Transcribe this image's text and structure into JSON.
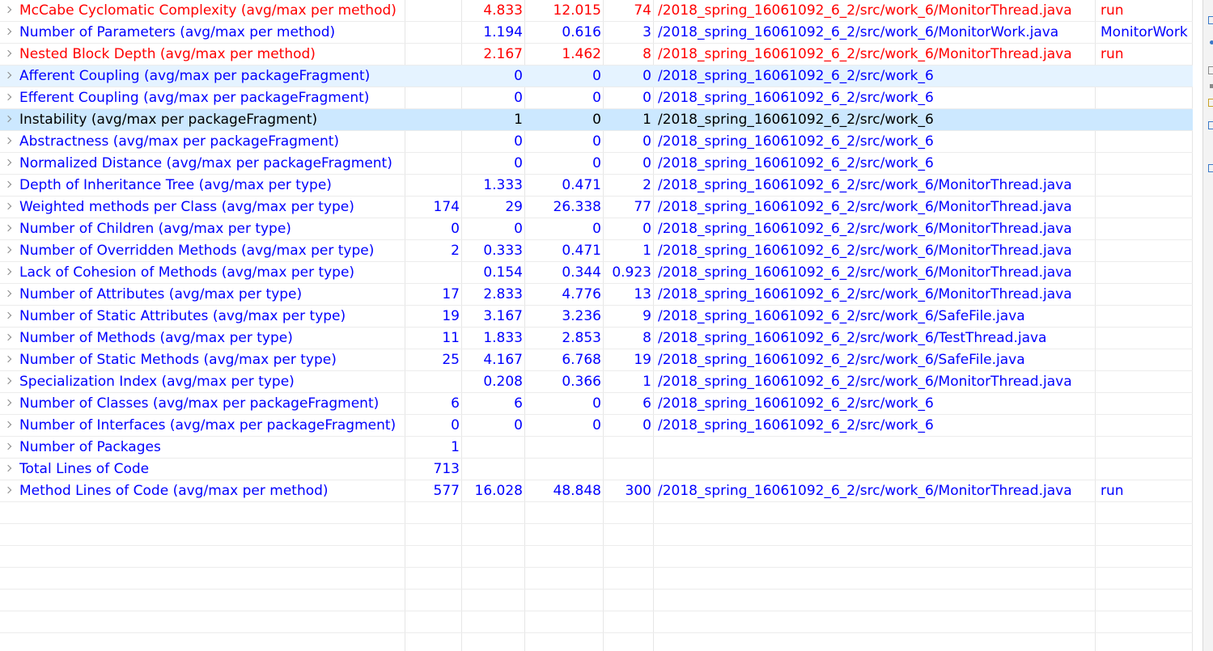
{
  "rows": [
    {
      "name": "McCabe Cyclomatic Complexity (avg/max per method)",
      "total": "",
      "mean": "4.833",
      "std": "12.015",
      "max": "74",
      "resource": "/2018_spring_16061092_6_2/src/work_6/MonitorThread.java",
      "method": "run",
      "state": "warn"
    },
    {
      "name": "Number of Parameters (avg/max per method)",
      "total": "",
      "mean": "1.194",
      "std": "0.616",
      "max": "3",
      "resource": "/2018_spring_16061092_6_2/src/work_6/MonitorWork.java",
      "method": "MonitorWork",
      "state": "normal"
    },
    {
      "name": "Nested Block Depth (avg/max per method)",
      "total": "",
      "mean": "2.167",
      "std": "1.462",
      "max": "8",
      "resource": "/2018_spring_16061092_6_2/src/work_6/MonitorThread.java",
      "method": "run",
      "state": "warn"
    },
    {
      "name": "Afferent Coupling (avg/max per packageFragment)",
      "total": "",
      "mean": "0",
      "std": "0",
      "max": "0",
      "resource": "/2018_spring_16061092_6_2/src/work_6",
      "method": "",
      "state": "hover"
    },
    {
      "name": "Efferent Coupling (avg/max per packageFragment)",
      "total": "",
      "mean": "0",
      "std": "0",
      "max": "0",
      "resource": "/2018_spring_16061092_6_2/src/work_6",
      "method": "",
      "state": "normal"
    },
    {
      "name": "Instability (avg/max per packageFragment)",
      "total": "",
      "mean": "1",
      "std": "0",
      "max": "1",
      "resource": "/2018_spring_16061092_6_2/src/work_6",
      "method": "",
      "state": "selected"
    },
    {
      "name": "Abstractness (avg/max per packageFragment)",
      "total": "",
      "mean": "0",
      "std": "0",
      "max": "0",
      "resource": "/2018_spring_16061092_6_2/src/work_6",
      "method": "",
      "state": "normal"
    },
    {
      "name": "Normalized Distance (avg/max per packageFragment)",
      "total": "",
      "mean": "0",
      "std": "0",
      "max": "0",
      "resource": "/2018_spring_16061092_6_2/src/work_6",
      "method": "",
      "state": "normal"
    },
    {
      "name": "Depth of Inheritance Tree (avg/max per type)",
      "total": "",
      "mean": "1.333",
      "std": "0.471",
      "max": "2",
      "resource": "/2018_spring_16061092_6_2/src/work_6/MonitorThread.java",
      "method": "",
      "state": "normal"
    },
    {
      "name": "Weighted methods per Class (avg/max per type)",
      "total": "174",
      "mean": "29",
      "std": "26.338",
      "max": "77",
      "resource": "/2018_spring_16061092_6_2/src/work_6/MonitorThread.java",
      "method": "",
      "state": "normal"
    },
    {
      "name": "Number of Children (avg/max per type)",
      "total": "0",
      "mean": "0",
      "std": "0",
      "max": "0",
      "resource": "/2018_spring_16061092_6_2/src/work_6/MonitorThread.java",
      "method": "",
      "state": "normal"
    },
    {
      "name": "Number of Overridden Methods (avg/max per type)",
      "total": "2",
      "mean": "0.333",
      "std": "0.471",
      "max": "1",
      "resource": "/2018_spring_16061092_6_2/src/work_6/MonitorThread.java",
      "method": "",
      "state": "normal"
    },
    {
      "name": "Lack of Cohesion of Methods (avg/max per type)",
      "total": "",
      "mean": "0.154",
      "std": "0.344",
      "max": "0.923",
      "resource": "/2018_spring_16061092_6_2/src/work_6/MonitorThread.java",
      "method": "",
      "state": "normal"
    },
    {
      "name": "Number of Attributes (avg/max per type)",
      "total": "17",
      "mean": "2.833",
      "std": "4.776",
      "max": "13",
      "resource": "/2018_spring_16061092_6_2/src/work_6/MonitorThread.java",
      "method": "",
      "state": "normal"
    },
    {
      "name": "Number of Static Attributes (avg/max per type)",
      "total": "19",
      "mean": "3.167",
      "std": "3.236",
      "max": "9",
      "resource": "/2018_spring_16061092_6_2/src/work_6/SafeFile.java",
      "method": "",
      "state": "normal"
    },
    {
      "name": "Number of Methods (avg/max per type)",
      "total": "11",
      "mean": "1.833",
      "std": "2.853",
      "max": "8",
      "resource": "/2018_spring_16061092_6_2/src/work_6/TestThread.java",
      "method": "",
      "state": "normal"
    },
    {
      "name": "Number of Static Methods (avg/max per type)",
      "total": "25",
      "mean": "4.167",
      "std": "6.768",
      "max": "19",
      "resource": "/2018_spring_16061092_6_2/src/work_6/SafeFile.java",
      "method": "",
      "state": "normal"
    },
    {
      "name": "Specialization Index (avg/max per type)",
      "total": "",
      "mean": "0.208",
      "std": "0.366",
      "max": "1",
      "resource": "/2018_spring_16061092_6_2/src/work_6/MonitorThread.java",
      "method": "",
      "state": "normal"
    },
    {
      "name": "Number of Classes (avg/max per packageFragment)",
      "total": "6",
      "mean": "6",
      "std": "0",
      "max": "6",
      "resource": "/2018_spring_16061092_6_2/src/work_6",
      "method": "",
      "state": "normal"
    },
    {
      "name": "Number of Interfaces (avg/max per packageFragment)",
      "total": "0",
      "mean": "0",
      "std": "0",
      "max": "0",
      "resource": "/2018_spring_16061092_6_2/src/work_6",
      "method": "",
      "state": "normal"
    },
    {
      "name": "Number of Packages",
      "total": "1",
      "mean": "",
      "std": "",
      "max": "",
      "resource": "",
      "method": "",
      "state": "normal"
    },
    {
      "name": "Total Lines of Code",
      "total": "713",
      "mean": "",
      "std": "",
      "max": "",
      "resource": "",
      "method": "",
      "state": "normal"
    },
    {
      "name": "Method Lines of Code (avg/max per method)",
      "total": "577",
      "mean": "16.028",
      "std": "48.848",
      "max": "300",
      "resource": "/2018_spring_16061092_6_2/src/work_6/MonitorThread.java",
      "method": "run",
      "state": "normal"
    }
  ],
  "colors": {
    "normal_text": "#0000ff",
    "warning_text": "#ff0000",
    "selected_text": "#000000",
    "hover_row": "#e5f3ff",
    "selected_row": "#cce8ff"
  },
  "icons": {
    "expand": "chevron-right-icon"
  }
}
